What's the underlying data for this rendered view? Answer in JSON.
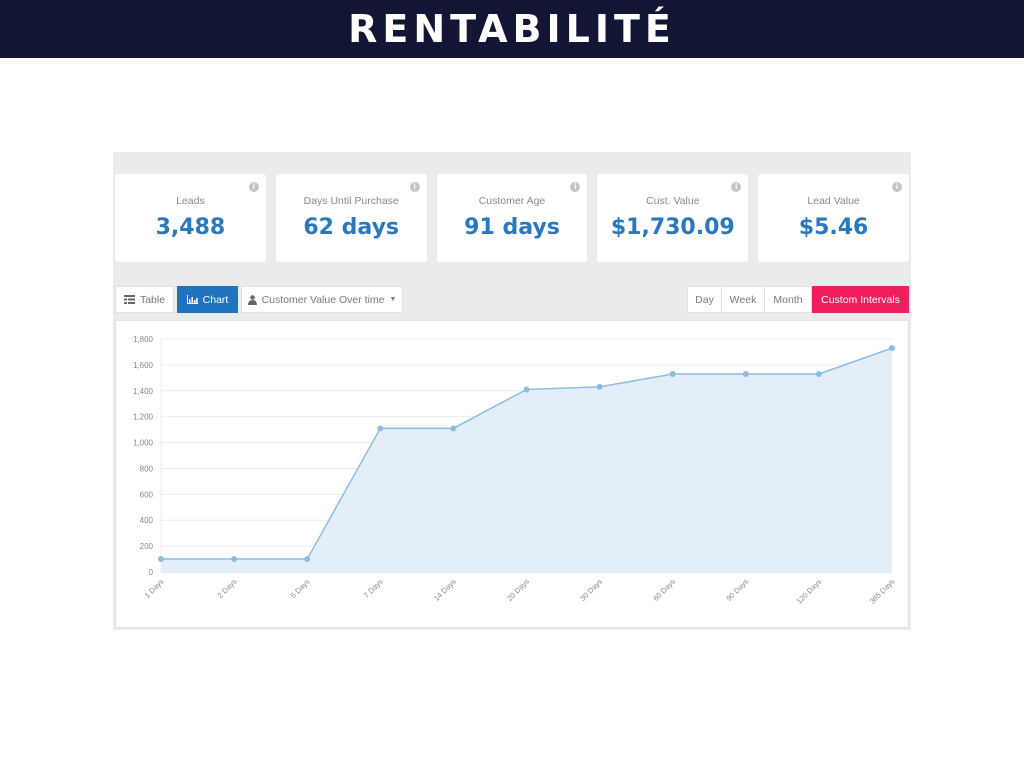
{
  "banner": {
    "title": "RENTABILITÉ"
  },
  "cards": [
    {
      "label": "Leads",
      "value": "3,488",
      "icon": "info-icon"
    },
    {
      "label": "Days Until Purchase",
      "value": "62 days",
      "icon": "info-icon"
    },
    {
      "label": "Customer Age",
      "value": "91 days",
      "icon": "info-icon"
    },
    {
      "label": "Cust. Value",
      "value": "$1,730.09",
      "icon": "info-icon"
    },
    {
      "label": "Lead Value",
      "value": "$5.46",
      "icon": "info-icon"
    }
  ],
  "toolbar": {
    "table_label": "Table",
    "chart_label": "Chart",
    "metric_dropdown": "Customer Value Over time",
    "intervals": [
      "Day",
      "Week",
      "Month",
      "Custom Intervals"
    ],
    "active_view": "Chart",
    "active_interval": "Custom Intervals"
  },
  "colors": {
    "banner": "#121533",
    "value_blue": "#2a78bd",
    "active_button": "#1f74bd",
    "custom_button": "#f01e5a",
    "line": "#8bbde3",
    "area": "#e4eef8"
  },
  "chart_data": {
    "type": "area",
    "title": "",
    "xlabel": "",
    "ylabel": "",
    "categories": [
      "1 Days",
      "2 Days",
      "5 Days",
      "7 Days",
      "14 Days",
      "20 Days",
      "30 Days",
      "60 Days",
      "90 Days",
      "120 Days",
      "365 Days"
    ],
    "series": [
      {
        "name": "Customer Value Over time",
        "values": [
          100,
          100,
          100,
          1110,
          1110,
          1410,
          1430,
          1530,
          1530,
          1530,
          1730
        ]
      }
    ],
    "ylim": [
      0,
      1800
    ],
    "yticks": [
      0,
      200,
      400,
      600,
      800,
      1000,
      1200,
      1400,
      1600,
      1800
    ],
    "ytick_labels": [
      "0",
      "200",
      "400",
      "600",
      "800",
      "1,000",
      "1,200",
      "1,400",
      "1,600",
      "1,800"
    ],
    "grid": true,
    "legend": "none"
  }
}
